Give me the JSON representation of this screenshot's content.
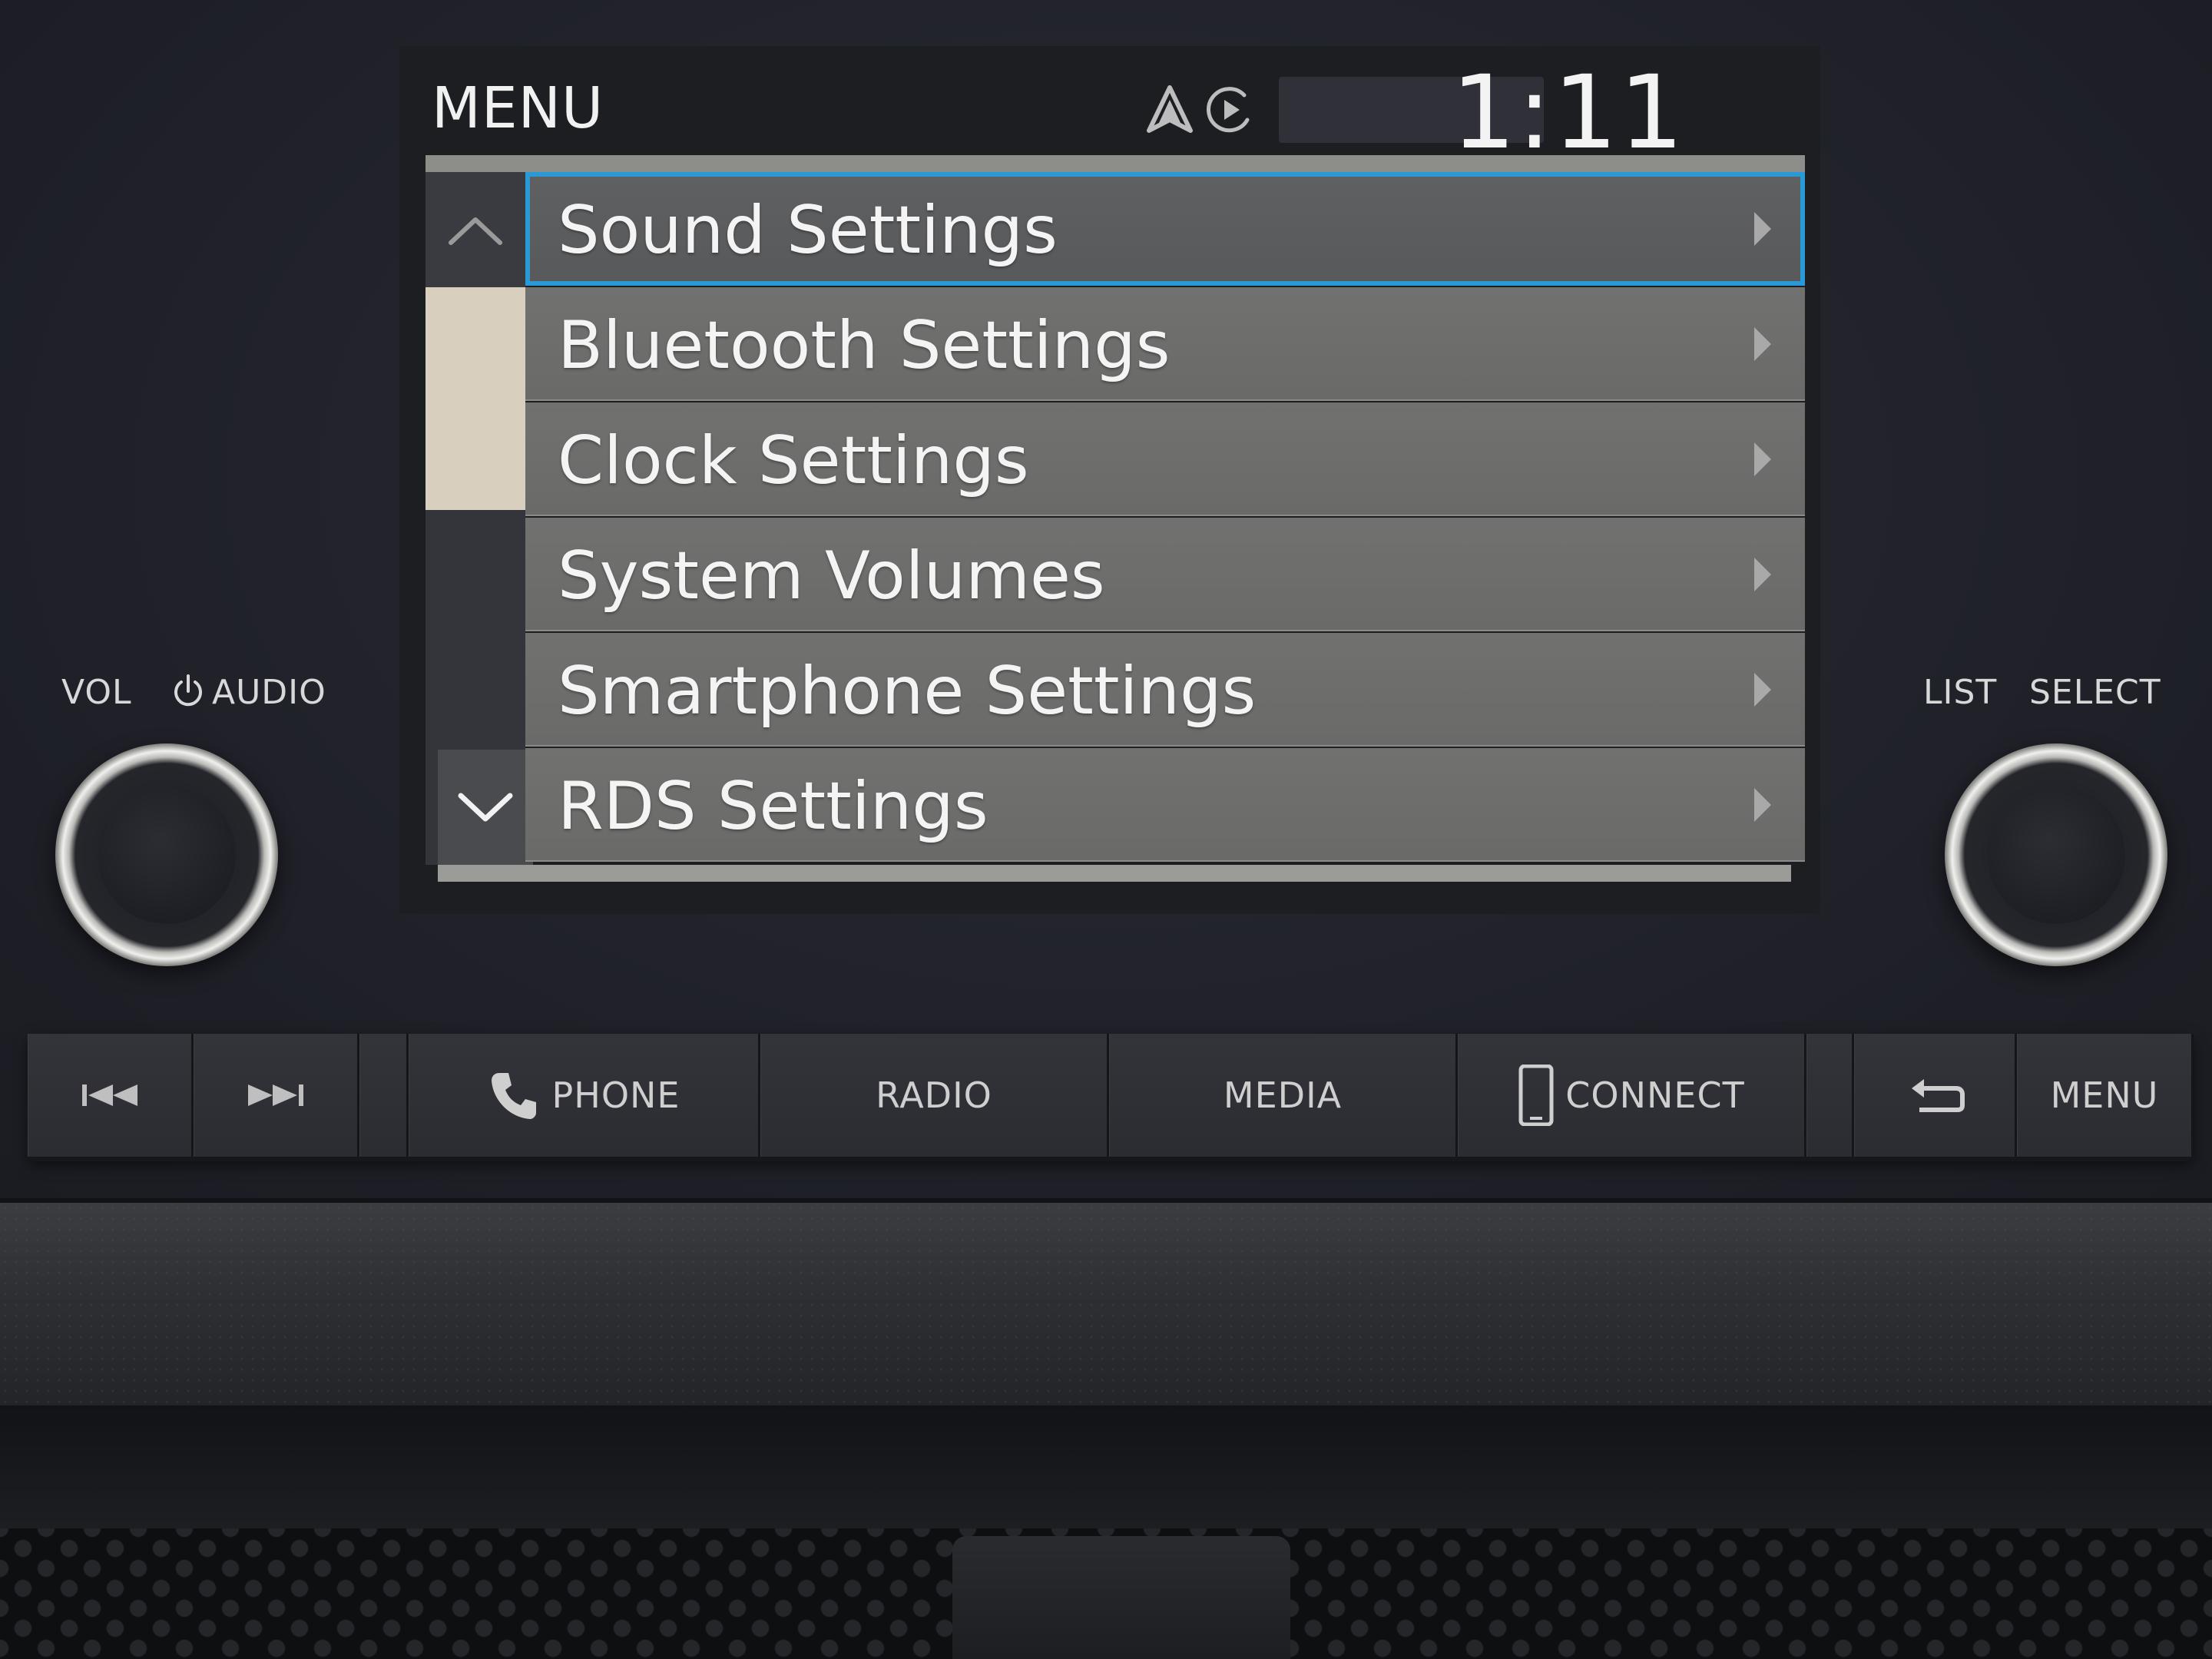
{
  "screen": {
    "title": "MENU",
    "clock": "1:11",
    "status_icons": [
      "navigation-arrow-icon",
      "play-circle-icon"
    ]
  },
  "menu": {
    "items": [
      {
        "label": "Sound Settings",
        "selected": true
      },
      {
        "label": "Bluetooth Settings",
        "selected": false
      },
      {
        "label": "Clock Settings",
        "selected": false
      },
      {
        "label": "System Volumes",
        "selected": false
      },
      {
        "label": "Smartphone Settings",
        "selected": false
      },
      {
        "label": "RDS Settings",
        "selected": false
      }
    ]
  },
  "knobs": {
    "left_label_vol": "VOL",
    "left_label_audio": "AUDIO",
    "right_label_list": "LIST",
    "right_label_select": "SELECT"
  },
  "buttons": {
    "phone": "PHONE",
    "radio": "RADIO",
    "media": "MEDIA",
    "connect": "CONNECT",
    "menu": "MENU"
  },
  "colors": {
    "selection_outline": "#2a9ad6",
    "scroll_thumb": "#d9cfbf"
  }
}
